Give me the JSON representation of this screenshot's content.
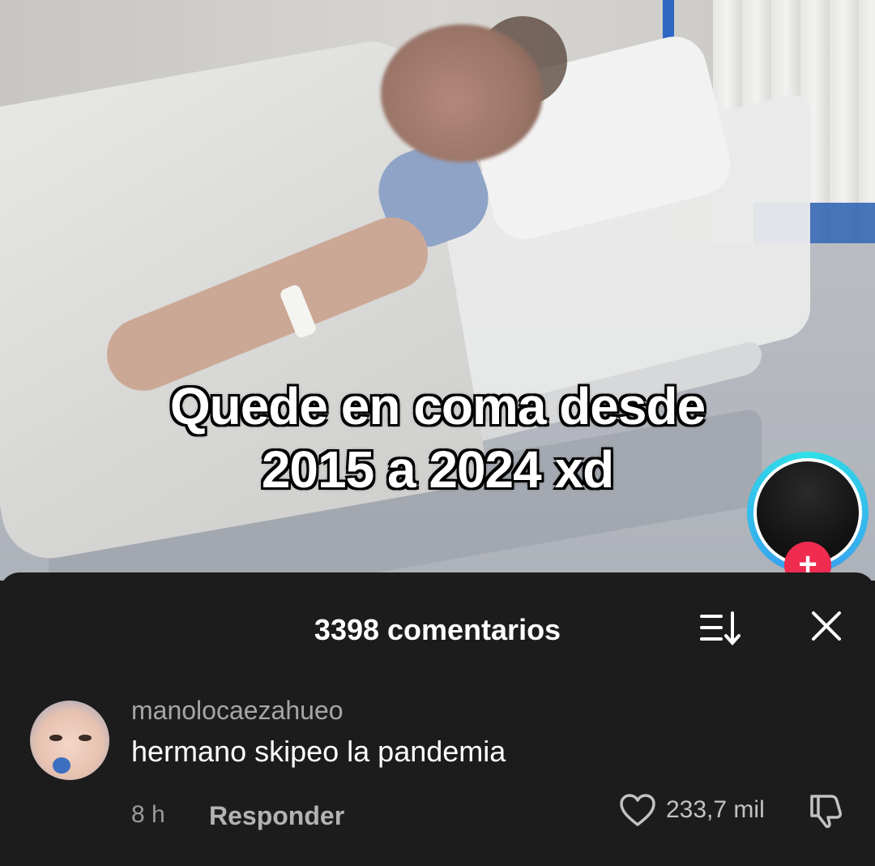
{
  "video": {
    "caption_line1": "Quede en coma desde",
    "caption_line2": "2015 a 2024 xd",
    "follow_icon": "plus-icon",
    "follow_label": "+"
  },
  "comments": {
    "header_title": "3398 comentarios",
    "sort_icon": "sort-icon",
    "close_icon": "close-icon",
    "items": [
      {
        "username": "manolocaezahueo",
        "text": "hermano skipeo la pandemia",
        "time": "8 h",
        "reply_label": "Responder",
        "likes": "233,7 mil",
        "like_icon": "heart-icon",
        "dislike_icon": "dislike-icon"
      }
    ]
  },
  "colors": {
    "sheet_background": "#1c1c1c",
    "follow_button": "#ef2b50",
    "avatar_ring": "#2fe0e7"
  }
}
